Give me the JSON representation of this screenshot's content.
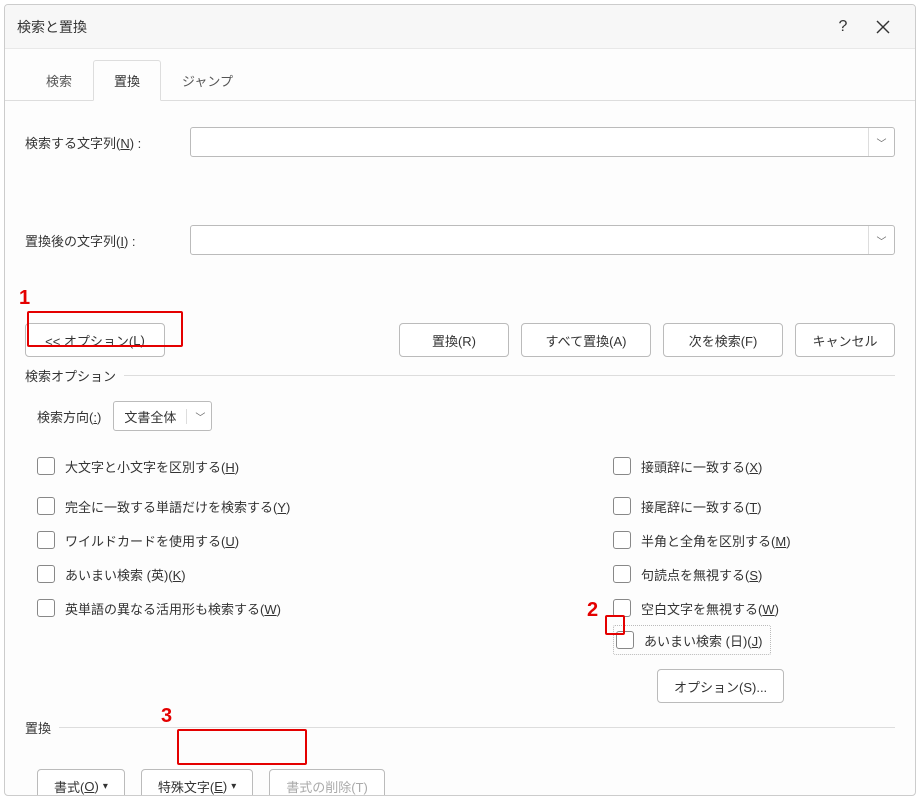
{
  "title": "検索と置換",
  "tabs": {
    "search": "検索",
    "replace": "置換",
    "jump": "ジャンプ"
  },
  "fields": {
    "find_label_pre": "検索する文字列(",
    "find_key": "N",
    "find_label_post": ") :",
    "find_value": "",
    "replace_label_pre": "置換後の文字列(",
    "replace_key": "I",
    "replace_label_post": ") :",
    "replace_value": ""
  },
  "buttons": {
    "options_toggle_pre": "<< オプション(",
    "options_toggle_key": "L",
    "options_toggle_post": ")",
    "replace": "置換(R)",
    "replace_all": "すべて置換(A)",
    "find_next": "次を検索(F)",
    "cancel": "キャンセル"
  },
  "options": {
    "section_title": "検索オプション",
    "direction_label_pre": "検索方向(",
    "direction_key": ":",
    "direction_label_post": ")",
    "direction_value": "文書全体",
    "left": {
      "case_pre": "大文字と小文字を区別する(",
      "case_key": "H",
      "case_post": ")",
      "whole_pre": "完全に一致する単語だけを検索する(",
      "whole_key": "Y",
      "whole_post": ")",
      "wildcard_pre": "ワイルドカードを使用する(",
      "wildcard_key": "U",
      "wildcard_post": ")",
      "fuzzy_en_pre": "あいまい検索 (英)(",
      "fuzzy_en_key": "K",
      "fuzzy_en_post": ")",
      "wordforms_pre": "英単語の異なる活用形も検索する(",
      "wordforms_key": "W",
      "wordforms_post": ")"
    },
    "right": {
      "prefix_pre": "接頭辞に一致する(",
      "prefix_key": "X",
      "prefix_post": ")",
      "suffix_pre": "接尾辞に一致する(",
      "suffix_key": "T",
      "suffix_post": ")",
      "width_pre": "半角と全角を区別する(",
      "width_key": "M",
      "width_post": ")",
      "punct_pre": "句読点を無視する(",
      "punct_key": "S",
      "punct_post": ")",
      "space_pre": "空白文字を無視する(",
      "space_key": "W",
      "space_post": ")",
      "fuzzy_jp_pre": "あいまい検索 (日)(",
      "fuzzy_jp_key": "J",
      "fuzzy_jp_post": ")",
      "options_btn": "オプション(S)..."
    }
  },
  "replace_section": {
    "title": "置換",
    "format_pre": "書式(",
    "format_key": "O",
    "format_post": ")",
    "special_pre": "特殊文字(",
    "special_key": "E",
    "special_post": ")",
    "clear_format": "書式の削除(T)"
  },
  "annotations": {
    "n1": "1",
    "n2": "2",
    "n3": "3"
  }
}
